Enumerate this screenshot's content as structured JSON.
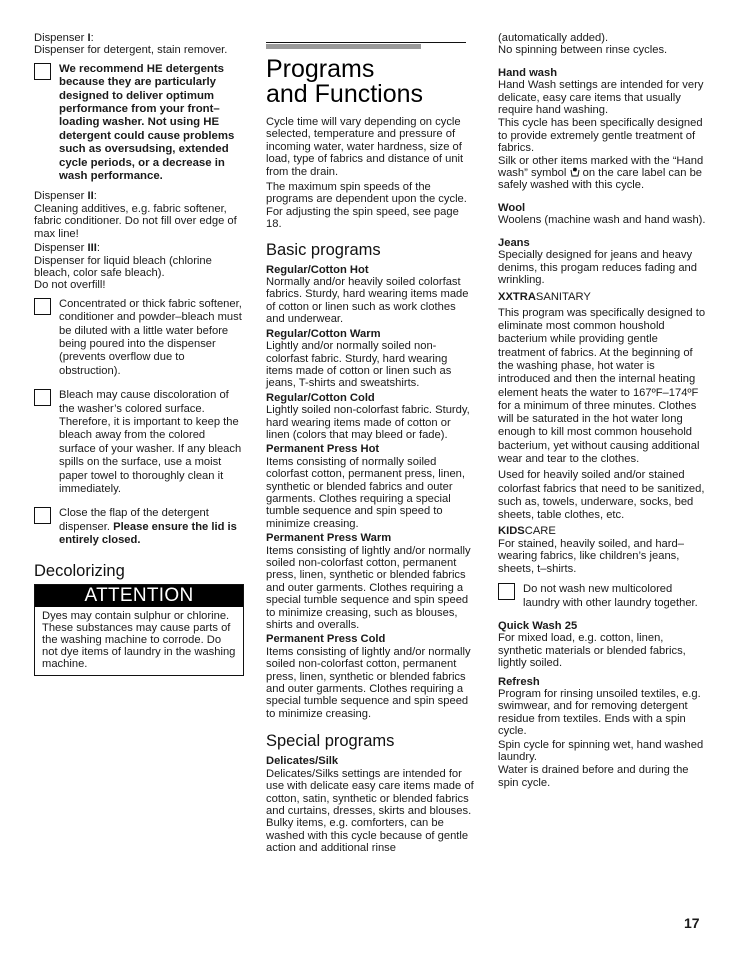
{
  "col1": {
    "dispenser1_label": "Dispenser ",
    "dispenser1_num": "I",
    "dispenser1_colon": ":",
    "dispenser1_text": "Dispenser for detergent, stain remover.",
    "note_he": "We recommend HE detergents because they are particularly designed to deliver optimum performance from your front–loading washer.  Not using HE detergent could cause problems such as oversudsing, extended cycle periods, or a decrease in wash performance.",
    "dispenser2_label": "Dispenser ",
    "dispenser2_num": "II",
    "dispenser2_colon": ":",
    "dispenser2_text": "Cleaning additives, e.g. fabric softener, fabric conditioner. Do not fill over edge of max line!",
    "dispenser3_label": "Dispenser ",
    "dispenser3_num": "III",
    "dispenser3_colon": ":",
    "dispenser3_text": "Dispenser for liquid bleach (chlorine bleach, color safe bleach).",
    "dispenser3_warning": "Do not overfill!",
    "note_concentrated": "Concentrated or thick fabric softener, conditioner and powder–bleach must be diluted with a little water before being poured into the dispenser (prevents overflow due to obstruction).",
    "note_bleach": "Bleach may cause discoloration of the washer’s colored surface. Therefore, it is important to keep the bleach away from the colored surface of your washer.  If any bleach spills on the surface, use a moist paper towel to thoroughly clean it immediately.",
    "note_flap_plain": "Close the flap of the detergent dispenser.  ",
    "note_flap_bold": "Please ensure the lid is entirely closed.",
    "decolorizing_heading": "Decolorizing",
    "attention_heading": "ATTENTION",
    "attention_text": "Dyes may contain sulphur or chlorine. These substances may cause parts of the washing machine to corrode. Do not dye items of laundry in the washing machine."
  },
  "col2": {
    "title_line1": "Programs",
    "title_line2": "and Functions",
    "intro1": "Cycle time will vary depending on cycle selected, temperature and pressure of incoming water, water hardness, size of load, type of fabrics and distance of unit from the drain.",
    "intro2": "The maximum spin speeds of the programs are dependent upon the cycle. For adjusting the spin speed, see page 18.",
    "basic_heading": "Basic programs",
    "basic_programs": [
      {
        "name": "Regular/Cotton Hot",
        "desc": "Normally and/or heavily soiled colorfast fabrics. Sturdy, hard wearing items made of cotton or linen such as work clothes and underwear."
      },
      {
        "name": "Regular/Cotton Warm",
        "desc": "Lightly and/or normally soiled non-colorfast fabric. Sturdy, hard wearing items made of cotton or linen such as jeans, T-shirts and sweatshirts."
      },
      {
        "name": "Regular/Cotton Cold",
        "desc": "Lightly soiled non-colorfast fabric. Sturdy, hard wearing items made of cotton or linen (colors that may bleed or fade)."
      },
      {
        "name": "Permanent Press Hot",
        "desc": "Items consisting of normally soiled colorfast cotton, permanent press, linen, synthetic or blended fabrics and outer garments. Clothes requiring a special tumble sequence and spin speed to minimize creasing."
      },
      {
        "name": "Permanent Press Warm",
        "desc": "Items consisting of lightly and/or normally soiled non-colorfast cotton, permanent press, linen, synthetic or blended fabrics and outer garments. Clothes requiring a special tumble sequence and spin speed to minimize creasing, such as blouses, shirts and overalls."
      },
      {
        "name": "Permanent Press Cold",
        "desc": "Items consisting of lightly and/or normally soiled non-colorfast cotton, permanent press, linen, synthetic or blended fabrics and outer garments. Clothes requiring a special tumble sequence and spin speed to minimize creasing."
      }
    ],
    "special_heading": "Special programs",
    "delicates_name": "Delicates/Silk",
    "delicates_desc1": "Delicates/Silks settings are intended for use with delicate easy care items made of cotton, satin, synthetic or blended fabrics and curtains, dresses, skirts and blouses.",
    "delicates_desc2": "Bulky items, e.g. comforters, can be washed with this cycle because of gentle action and additional rinse"
  },
  "col3": {
    "delicates_cont1": "(automatically added).",
    "delicates_cont2": "No spinning between rinse cycles.",
    "handwash_name": "Hand wash",
    "handwash_desc1": "Hand Wash settings are intended for very delicate, easy care items that usually require hand washing.",
    "handwash_desc2": "This cycle has been specifically designed to provide extremely gentle treatment of fabrics.",
    "handwash_desc3_a": "Silk or other items marked with the “Hand wash” symbol ",
    "handwash_desc3_b": " on the care label can be safely washed with this cycle.",
    "wool_name": "Wool",
    "wool_desc": "Woolens (machine wash and hand wash).",
    "jeans_name": "Jeans",
    "jeans_desc": "Specially designed for jeans and heavy denims, this progam reduces fading and wrinkling.",
    "xxtra_name_bold": "XXTRA",
    "xxtra_name_light": "SANITARY",
    "xxtra_desc1": "This program was specifically designed to eliminate most common houshold bacterium while providing gentle treatment of fabrics.  At the beginning of the washing phase, hot water is introduced and then the internal heating element heats the water to 167ºF–174ºF for a minimum of three minutes.  Clothes will be saturated in the hot water long enough to kill most common household bacterium, yet without causing additional wear and tear to the clothes.",
    "xxtra_desc2": "Used for heavily soiled and/or stained colorfast fabrics that need to be sanitized, such as, towels, underware, socks, bed sheets, table clothes, etc.",
    "kids_name_bold": "KIDS",
    "kids_name_light": "CARE",
    "kids_desc": "For stained, heavily soiled, and hard–wearing fabrics, like children’s jeans, sheets, t–shirts.",
    "note_multicolor": "Do not wash new multicolored laundry with other laundry together.",
    "quick_name": "Quick Wash 25",
    "quick_desc": "For mixed load, e.g. cotton, linen, synthetic materials or blended fabrics, lightly soiled.",
    "refresh_name": "Refresh",
    "refresh_desc1": "Program for rinsing unsoiled textiles, e.g. swimwear, and for removing detergent residue from textiles. Ends with a spin cycle.",
    "refresh_desc2": "Spin cycle for spinning wet, hand washed laundry.",
    "refresh_desc3": "Water is drained before and during the spin cycle."
  },
  "footer": {
    "page_number": "17"
  },
  "icons": {
    "note_box": "note-checkbox-icon",
    "hand_wash": "hand-wash-icon"
  }
}
